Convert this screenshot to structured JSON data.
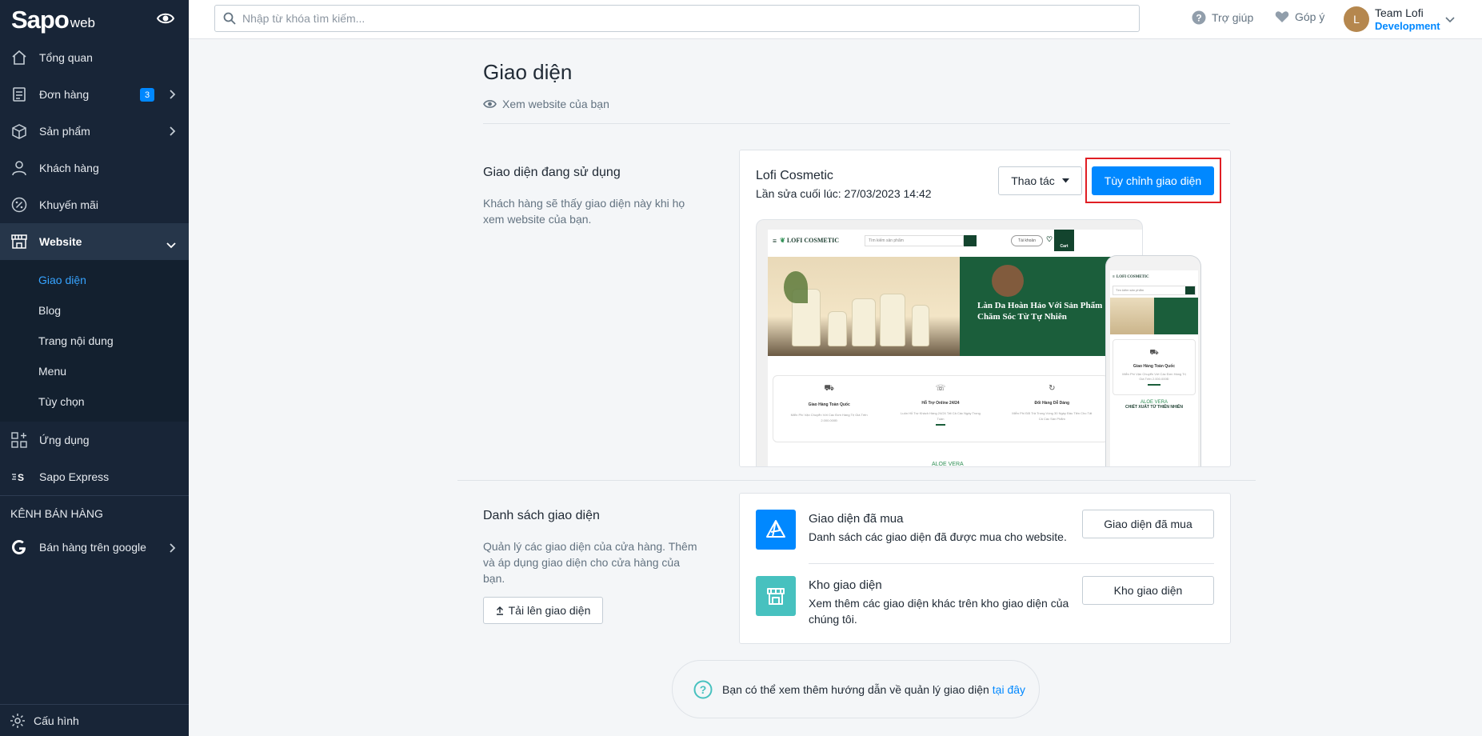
{
  "sidebar": {
    "logo": "Sapo",
    "logo_sub": "web",
    "items": [
      {
        "label": "Tổng quan"
      },
      {
        "label": "Đơn hàng",
        "badge": "3"
      },
      {
        "label": "Sản phẩm"
      },
      {
        "label": "Khách hàng"
      },
      {
        "label": "Khuyến mãi"
      },
      {
        "label": "Website"
      }
    ],
    "website_sub": [
      {
        "label": "Giao diện"
      },
      {
        "label": "Blog"
      },
      {
        "label": "Trang nội dung"
      },
      {
        "label": "Menu"
      },
      {
        "label": "Tùy chọn"
      }
    ],
    "apps_label": "Ứng dụng",
    "express_label": "Sapo Express",
    "channels_title": "KÊNH BÁN HÀNG",
    "google_label": "Bán hàng trên google",
    "settings_label": "Cấu hình"
  },
  "topbar": {
    "search_placeholder": "Nhập từ khóa tìm kiếm...",
    "help_label": "Trợ giúp",
    "feedback_label": "Góp ý",
    "user_initial": "L",
    "user_name": "Team Lofi",
    "user_role": "Development"
  },
  "page": {
    "title": "Giao diện",
    "view_website": "Xem website của bạn"
  },
  "current_theme": {
    "section_title": "Giao diện đang sử dụng",
    "section_desc": "Khách hàng sẽ thấy giao diện này khi họ xem website của bạn.",
    "name": "Lofi Cosmetic",
    "last_edited": "Lần sửa cuối lúc: 27/03/2023 14:42",
    "actions_label": "Thao tác",
    "customize_label": "Tùy chỉnh giao diện",
    "preview": {
      "brand": "LOFI COSMETIC",
      "search_placeholder": "Tìm kiếm sản phẩm",
      "login_label": "Tài khoản",
      "cart_label": "Cart",
      "banner_title": "Làn Da Hoàn Hảo Với Sản Phẩm Chăm Sóc Từ Tự Nhiên",
      "features": [
        {
          "title": "Giao Hàng Toàn Quốc",
          "desc": "Miễn Phí Vận Chuyển Với Các Đơn Hàng Trị Giá Trên 2.000.000Đ"
        },
        {
          "title": "Hỗ Trợ Online 24/24",
          "desc": "Luôn Hỗ Trợ Khách Hàng 24/24 Tất Cả Các Ngày Trong Tuần"
        },
        {
          "title": "Đổi Hàng Dễ Dàng",
          "desc": "Miễn Phí Đổi Trả Trong Vòng 30 Ngày Đầu Tiên Cho Tất Cả Các Sản Phẩm"
        }
      ],
      "aloe_label": "ALOE VERA",
      "mobile_brand": "LOFI COSMETIC",
      "mobile_search": "Tìm kiếm sản phẩm",
      "mobile_feature_title": "Giao Hàng Toàn Quốc",
      "mobile_feature_desc": "Miễn Phí Vận Chuyển Với Các Đơn Hàng Trị Giá Trên 2.000.000Đ",
      "mobile_aloe": "ALOE VERA",
      "mobile_sub": "CHIẾT XUẤT TỪ THIÊN NHIÊN"
    }
  },
  "theme_list": {
    "section_title": "Danh sách giao diện",
    "section_desc": "Quản lý các giao diện của cửa hàng. Thêm và áp dụng giao diện cho cửa hàng của bạn.",
    "upload_label": "Tải lên giao diện",
    "purchased": {
      "title": "Giao diện đã mua",
      "desc": "Danh sách các giao diện đã được mua cho website.",
      "button": "Giao diện đã mua",
      "color": "#0088ff"
    },
    "store": {
      "title": "Kho giao diện",
      "desc": "Xem thêm các giao diện khác trên kho giao diện của chúng tôi.",
      "button": "Kho giao diện",
      "color": "#47c1bf"
    }
  },
  "help": {
    "text": "Bạn có thể xem thêm hướng dẫn về quản lý giao diện",
    "link": "tại đây"
  }
}
